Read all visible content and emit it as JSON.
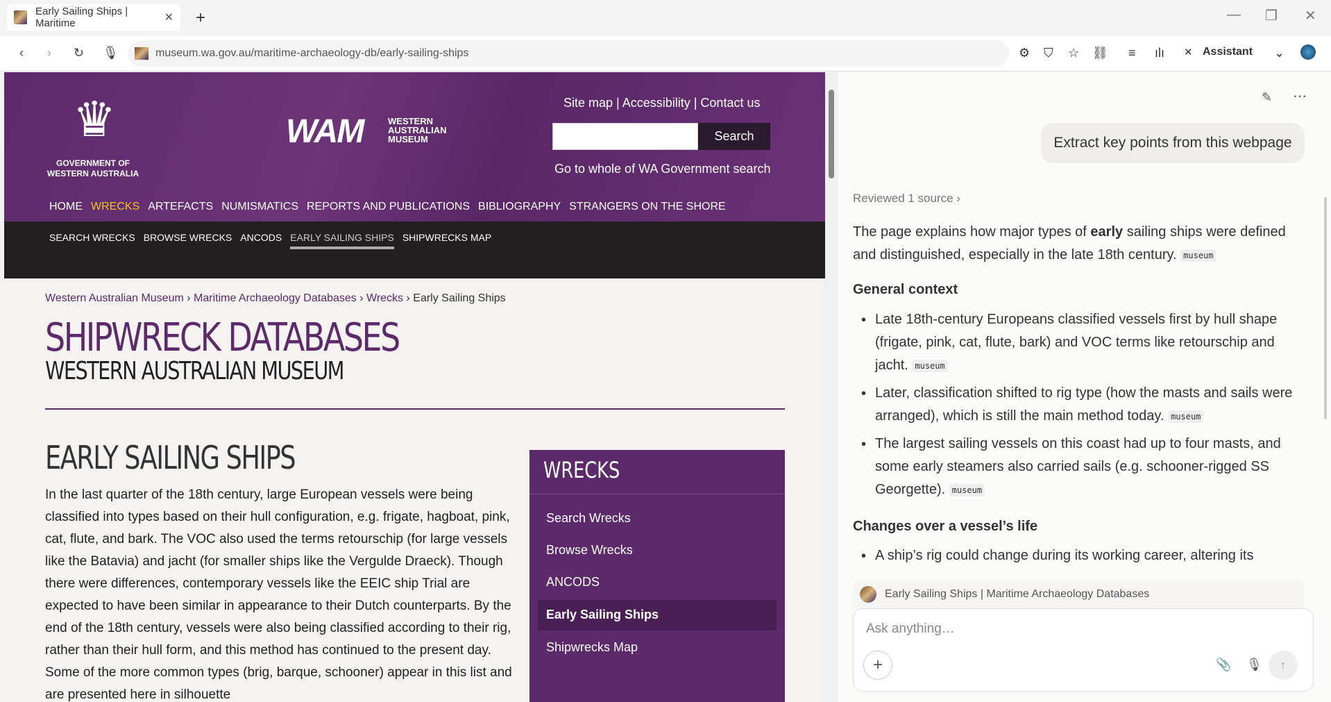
{
  "browser": {
    "tab_title": "Early Sailing Ships | Maritime",
    "url": "museum.wa.gov.au/maritime-archaeology-db/early-sailing-ships",
    "assistant_label": "Assistant"
  },
  "site": {
    "govt_label": "GOVERNMENT OF WESTERN AUSTRALIA",
    "logo_text": "WAM",
    "logo_sub": "WESTERN AUSTRALIAN MUSEUM",
    "top_links": "Site map | Accessibility | Contact us",
    "search_button": "Search",
    "gov_search": "Go to whole of WA Government search",
    "main_nav": [
      "HOME",
      "WRECKS",
      "ARTEFACTS",
      "NUMISMATICS",
      "REPORTS AND PUBLICATIONS",
      "BIBLIOGRAPHY",
      "STRANGERS ON THE SHORE"
    ],
    "sub_nav": [
      "SEARCH WRECKS",
      "BROWSE WRECKS",
      "ANCODS",
      "EARLY SAILING SHIPS",
      "SHIPWRECKS MAP"
    ],
    "breadcrumb": {
      "c1": "Western Australian Museum",
      "c2": "Maritime Archaeology Databases",
      "c3": "Wrecks",
      "c4": "Early Sailing Ships",
      "sep": " › "
    },
    "title": "SHIPWRECK DATABASES",
    "subtitle": "WESTERN AUSTRALIAN MUSEUM",
    "heading": "EARLY SAILING SHIPS",
    "paragraph": "In the last quarter of the 18th century, large European vessels were being classified into types based on their hull configuration, e.g. frigate, hagboat, pink, cat, flute, and bark. The VOC also used the terms retourschip (for large vessels like the Batavia) and jacht (for smaller ships like the Vergulde Draeck). Though there were differences, contemporary vessels like the EEIC ship Trial are expected to have been similar in appearance to their Dutch counterparts. By the end of the 18th century, vessels were also being classified according to their rig, rather than their hull form, and this method has continued to the present day. Some of the more common types (brig, barque, schooner) appear in this list and are presented here in silhouette",
    "sidebar_title": "WRECKS",
    "sidebar_items": [
      "Search Wrecks",
      "Browse Wrecks",
      "ANCODS",
      "Early Sailing Ships",
      "Shipwrecks Map"
    ]
  },
  "assistant": {
    "user_message": "Extract key points from this webpage",
    "reviewed": "Reviewed 1 source",
    "intro_a": "The page explains how major types of",
    "intro_bold": "early",
    "intro_b": "sailing ships were defined and distinguished, especially in the late 18th century.",
    "cite": "museum",
    "section1": "General context",
    "b1": "Late 18th-century Europeans classified vessels first by hull shape (frigate, pink, cat, flute, bark) and VOC terms like retourschip and jacht.",
    "b2": "Later, classification shifted to rig type (how the masts and sails were arranged), which is still the main method today.",
    "b3": "The largest sailing vessels on this coast had up to four masts, and some early steamers also carried sails (e.g. schooner-rigged SS Georgette).",
    "section2": "Changes over a vessel’s life",
    "b4": "A ship’s rig could change during its working career, altering its",
    "source_title": "Early Sailing Ships | Maritime Archaeology Databases",
    "input_placeholder": "Ask anything…"
  }
}
